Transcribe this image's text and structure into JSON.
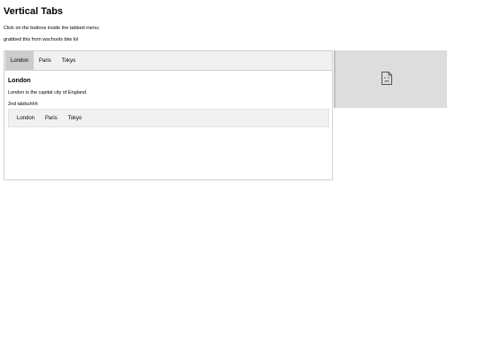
{
  "page": {
    "title": "Vertical Tabs",
    "instruction": "Click on the buttons inside the tabbed menu:",
    "note": "grabbed this from wschools btw lol"
  },
  "tabs": [
    {
      "label": "London"
    },
    {
      "label": "Paris"
    },
    {
      "label": "Tokyo"
    }
  ],
  "active_tab": "London",
  "content": {
    "heading": "London",
    "text": "London is the capital city of England.",
    "second_label": "2nd tabbuhhh"
  },
  "inner_tabs": [
    {
      "label": "London"
    },
    {
      "label": "Paris"
    },
    {
      "label": "Tokyo"
    }
  ],
  "image": {
    "icon": "broken-image-icon"
  },
  "colors": {
    "tabbar_bg": "#f1f1f1",
    "active_tab_bg": "#cccccc",
    "image_placeholder_bg": "#dddddd"
  }
}
